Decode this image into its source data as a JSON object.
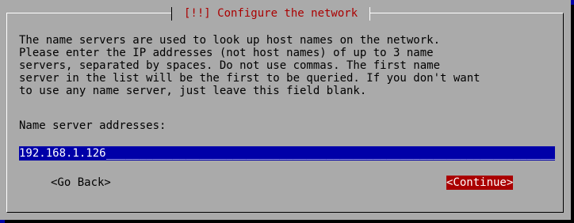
{
  "dialog": {
    "title": "[!!] Configure the network",
    "description": "The name servers are used to look up host names on the network.\nPlease enter the IP addresses (not host names) of up to 3 name\nservers, separated by spaces. Do not use commas. The first name\nserver in the list will be the first to be queried. If you don't want\nto use any name server, just leave this field blank.",
    "field_label": "Name server addresses:",
    "field_value": "192.168.1.126",
    "field_fill": "________________________________________________________________________________",
    "back_label": "<Go Back>",
    "continue_label": "<Continue>"
  },
  "colors": {
    "background": "#0000a8",
    "panel": "#aaaaaa",
    "title": "#aa0000",
    "input_bg": "#0000a8",
    "selected_button_bg": "#aa0000"
  }
}
